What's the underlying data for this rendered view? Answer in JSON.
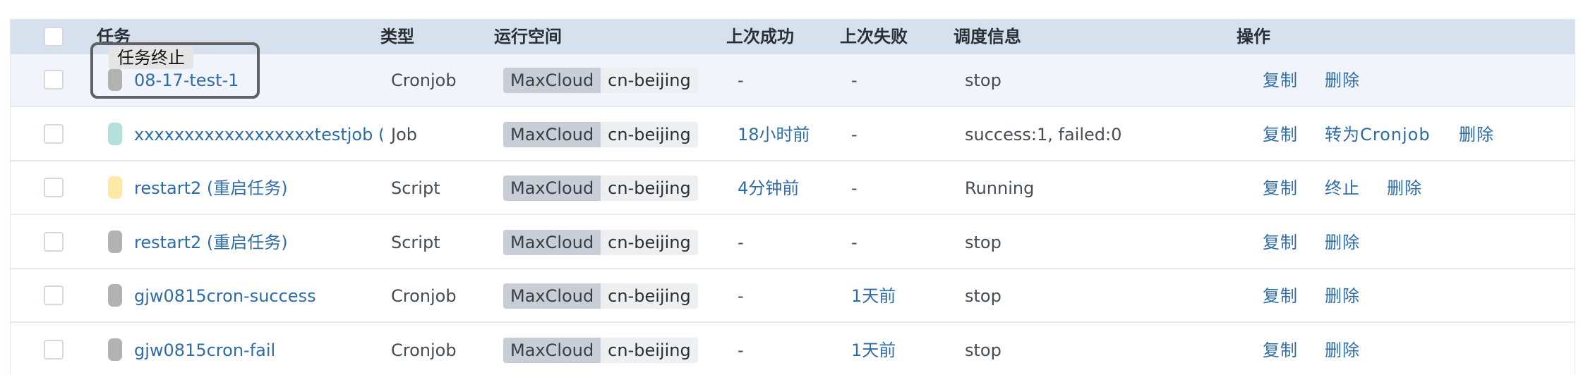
{
  "header": {
    "task": "任务",
    "type": "类型",
    "space": "运行空间",
    "last_success": "上次成功",
    "last_failure": "上次失败",
    "schedule": "调度信息",
    "actions": "操作"
  },
  "tooltip": "任务终止",
  "status_colors": {
    "gray": "#b2b2b2",
    "teal": "#b4e0dc",
    "yellow": "#fde9a6"
  },
  "rows": [
    {
      "status": "gray",
      "name": "08-17-test-1",
      "type": "Cronjob",
      "space_tag": "MaxCloud",
      "space_region": "cn-beijing",
      "last_success": "-",
      "last_failure": "-",
      "schedule": "stop",
      "actions": [
        "复制",
        "删除"
      ]
    },
    {
      "status": "teal",
      "name": "xxxxxxxxxxxxxxxxxxtestjob (一次",
      "type": "Job",
      "space_tag": "MaxCloud",
      "space_region": "cn-beijing",
      "last_success": "18小时前",
      "last_failure": "-",
      "schedule": "success:1, failed:0",
      "actions": [
        "复制",
        "转为Cronjob",
        "删除"
      ]
    },
    {
      "status": "yellow",
      "name": "restart2 (重启任务)",
      "type": "Script",
      "space_tag": "MaxCloud",
      "space_region": "cn-beijing",
      "last_success": "4分钟前",
      "last_failure": "-",
      "schedule": "Running",
      "actions": [
        "复制",
        "终止",
        "删除"
      ]
    },
    {
      "status": "gray",
      "name": "restart2 (重启任务)",
      "type": "Script",
      "space_tag": "MaxCloud",
      "space_region": "cn-beijing",
      "last_success": "-",
      "last_failure": "-",
      "schedule": "stop",
      "actions": [
        "复制",
        "删除"
      ]
    },
    {
      "status": "gray",
      "name": "gjw0815cron-success",
      "type": "Cronjob",
      "space_tag": "MaxCloud",
      "space_region": "cn-beijing",
      "last_success": "-",
      "last_failure": "1天前",
      "schedule": "stop",
      "actions": [
        "复制",
        "删除"
      ]
    },
    {
      "status": "gray",
      "name": "gjw0815cron-fail",
      "type": "Cronjob",
      "space_tag": "MaxCloud",
      "space_region": "cn-beijing",
      "last_success": "-",
      "last_failure": "1天前",
      "schedule": "stop",
      "actions": [
        "复制",
        "删除"
      ]
    }
  ]
}
